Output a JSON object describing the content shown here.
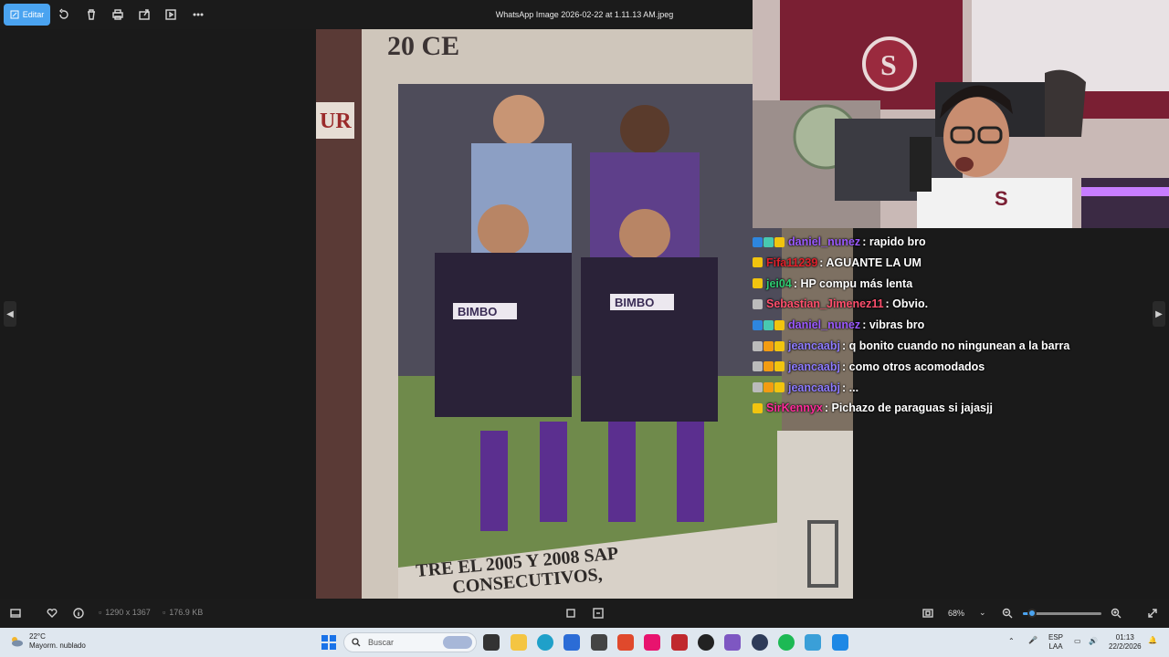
{
  "toolbar": {
    "edit_label": "Editar",
    "file_title": "WhatsApp Image 2026-02-22 at 1.11.13 AM.jpeg"
  },
  "photo": {
    "caption_top": "20 CE",
    "caption_bottom_1": "TRE EL 2005 Y 2008 SAP",
    "caption_bottom_2": "CONSECUTIVOS,",
    "side_text": "UR",
    "jersey_sponsor": "BIMBO"
  },
  "statusbar": {
    "dimensions": "1290 x 1367",
    "file_size": "176.9 KB",
    "zoom": "68%",
    "zoom_level": 0.12
  },
  "chat": [
    {
      "user": "daniel_nunez",
      "color": "#9b59ff",
      "badges": [
        "#2e86de",
        "#48c9b0",
        "#f1c40f"
      ],
      "message": ": rapido bro"
    },
    {
      "user": "Fifa11239",
      "color": "#e0202b",
      "badges": [
        "#f1c40f"
      ],
      "message": ": AGUANTE LA UM"
    },
    {
      "user": "jei04",
      "color": "#2ecc71",
      "badges": [
        "#f1c40f"
      ],
      "message": ": HP compu más lenta"
    },
    {
      "user": "Sebastian_Jimenez11",
      "color": "#ff4f6d",
      "badges": [
        "#bbbbbb"
      ],
      "message": ": Obvio."
    },
    {
      "user": "daniel_nunez",
      "color": "#9b59ff",
      "badges": [
        "#2e86de",
        "#48c9b0",
        "#f1c40f"
      ],
      "message": ": vibras bro"
    },
    {
      "user": "jeancaabj",
      "color": "#8e7cff",
      "badges": [
        "#bbbbbb",
        "#f39c12",
        "#f1c40f"
      ],
      "message": ": q bonito cuando no ningunean a la barra"
    },
    {
      "user": "jeancaabj",
      "color": "#8e7cff",
      "badges": [
        "#bbbbbb",
        "#f39c12",
        "#f1c40f"
      ],
      "message": ": como otros acomodados"
    },
    {
      "user": "jeancaabj",
      "color": "#8e7cff",
      "badges": [
        "#bbbbbb",
        "#f39c12",
        "#f1c40f"
      ],
      "message": ": ..."
    },
    {
      "user": "SirKennyx",
      "color": "#ff2d9b",
      "badges": [
        "#f1c40f"
      ],
      "message": ": Pichazo de paraguas si jajasjj"
    }
  ],
  "taskbar": {
    "temperature": "22°C",
    "weather_desc": "Mayorm. nublado",
    "search_placeholder": "Buscar",
    "lang_1": "ESP",
    "lang_2": "LAA",
    "time": "01:13",
    "date": "22/2/2026"
  }
}
